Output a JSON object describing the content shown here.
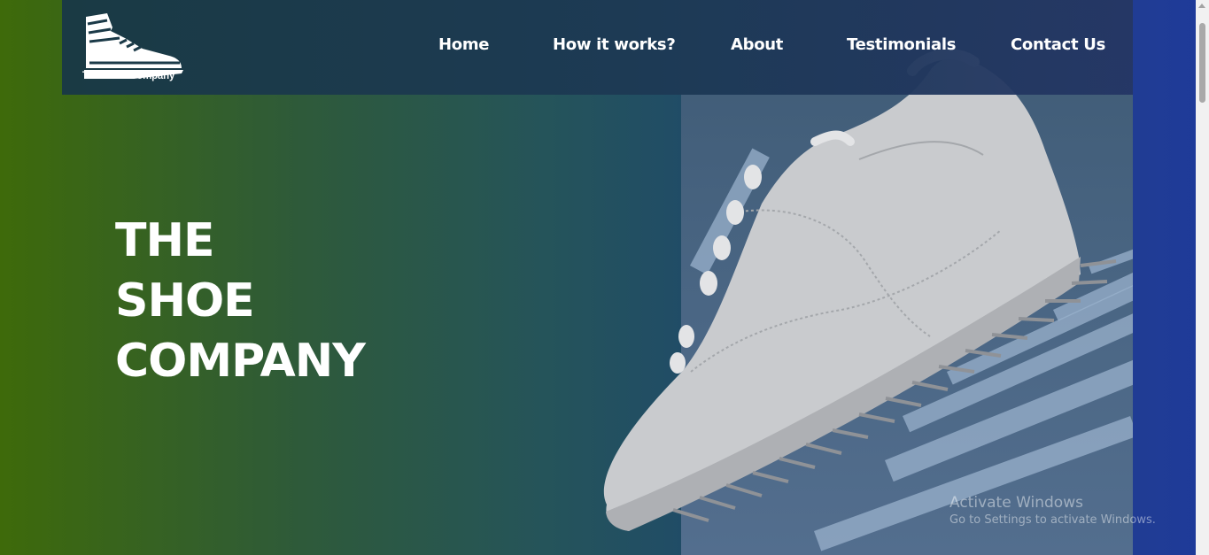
{
  "brand": {
    "name": "The Shoe Company"
  },
  "nav": {
    "items": [
      {
        "label": "Home"
      },
      {
        "label": "How it works?"
      },
      {
        "label": "About"
      },
      {
        "label": "Testimonials"
      },
      {
        "label": "Contact Us"
      }
    ]
  },
  "hero": {
    "title_lines": [
      "THE",
      "SHOE",
      "COMPANY"
    ],
    "image": "white-sneaker-photo"
  },
  "watermark": {
    "title": "Activate Windows",
    "subtitle": "Go to Settings to activate Windows."
  },
  "colors": {
    "gradient_start": "#3e6a0a",
    "gradient_end": "#1e3a9a",
    "navbar": "#1d3a55",
    "text": "#ffffff"
  },
  "icons": {
    "logo": "sneaker-logo-icon"
  }
}
